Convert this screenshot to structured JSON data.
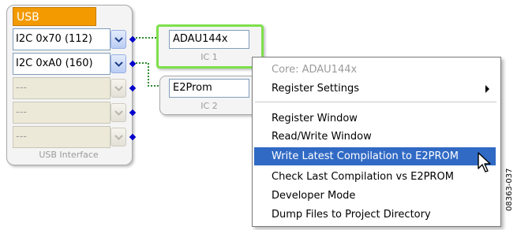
{
  "usb_interface": {
    "title": "USB",
    "caption": "USB Interface",
    "ports": [
      {
        "value": "I2C 0x70 (112)",
        "enabled": true
      },
      {
        "value": "I2C 0xA0 (160)",
        "enabled": true
      },
      {
        "value": "---",
        "enabled": false
      },
      {
        "value": "---",
        "enabled": false
      },
      {
        "value": "---",
        "enabled": false
      }
    ]
  },
  "ic_blocks": [
    {
      "name": "ADAU144x",
      "label": "IC 1",
      "selected": true
    },
    {
      "name": "E2Prom",
      "label": "IC 2",
      "selected": false
    }
  ],
  "context_menu": {
    "header": "Core: ADAU144x",
    "register_settings": "Register Settings",
    "register_window": "Register Window",
    "read_write_window": "Read/Write Window",
    "write_latest": "Write Latest Compilation to E2PROM",
    "check_last": "Check Last Compilation vs E2PROM",
    "developer_mode": "Developer Mode",
    "dump_files": "Dump Files to Project Directory"
  },
  "figure_code": "08363-037",
  "colors": {
    "usb_title": "#f29a00",
    "highlight": "#316ac5",
    "selected_border": "#7ee04a",
    "connection_blue": "#0000cc",
    "connection_green": "#2f8a2f"
  }
}
